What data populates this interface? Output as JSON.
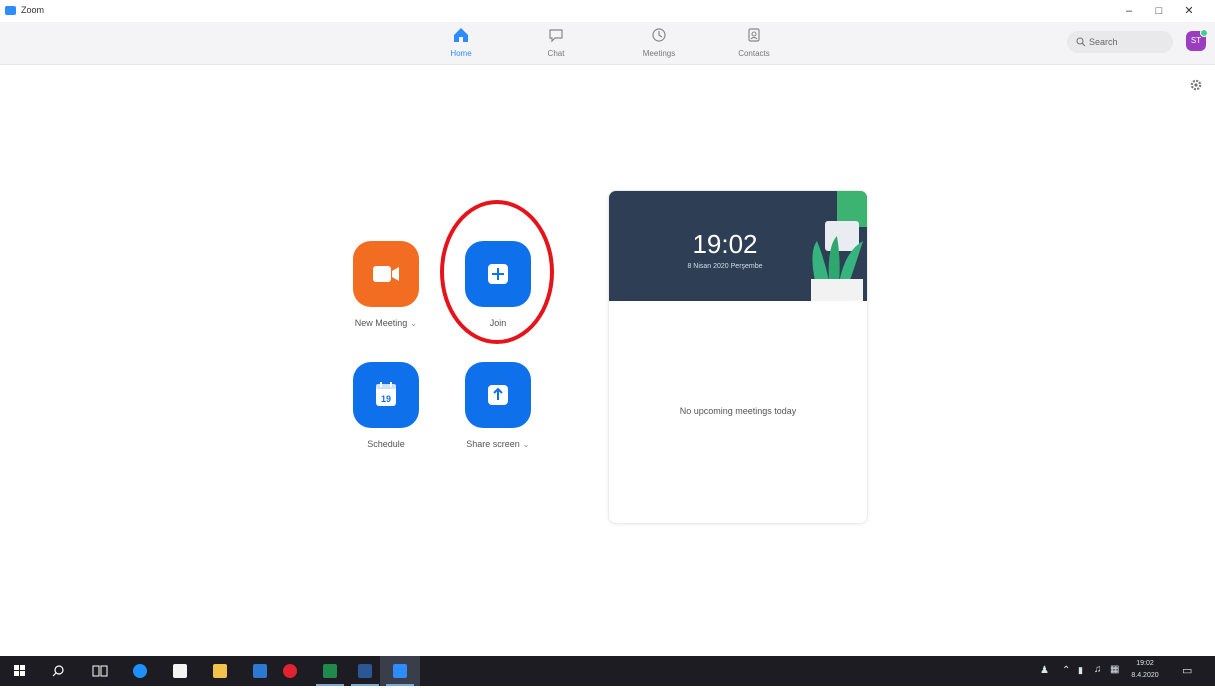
{
  "window": {
    "title": "Zoom"
  },
  "nav": {
    "tabs": [
      {
        "label": "Home"
      },
      {
        "label": "Chat"
      },
      {
        "label": "Meetings"
      },
      {
        "label": "Contacts"
      }
    ],
    "search_placeholder": "Search",
    "avatar_initials": "ST"
  },
  "actions": {
    "new_meeting": "New Meeting",
    "join": "Join",
    "schedule": "Schedule",
    "schedule_day": "19",
    "share_screen": "Share screen"
  },
  "meeting_card": {
    "time": "19:02",
    "date": "8 Nisan 2020 Perşembe",
    "empty_message": "No upcoming meetings today"
  },
  "taskbar": {
    "clock_time": "19:02",
    "clock_date": "8.4.2020"
  },
  "colors": {
    "accent": "#2d8cff",
    "new_meeting_button": "#f26d21",
    "action_button": "#0e71eb",
    "highlight_ring": "#e5141a",
    "card_header": "#2e3e54"
  }
}
